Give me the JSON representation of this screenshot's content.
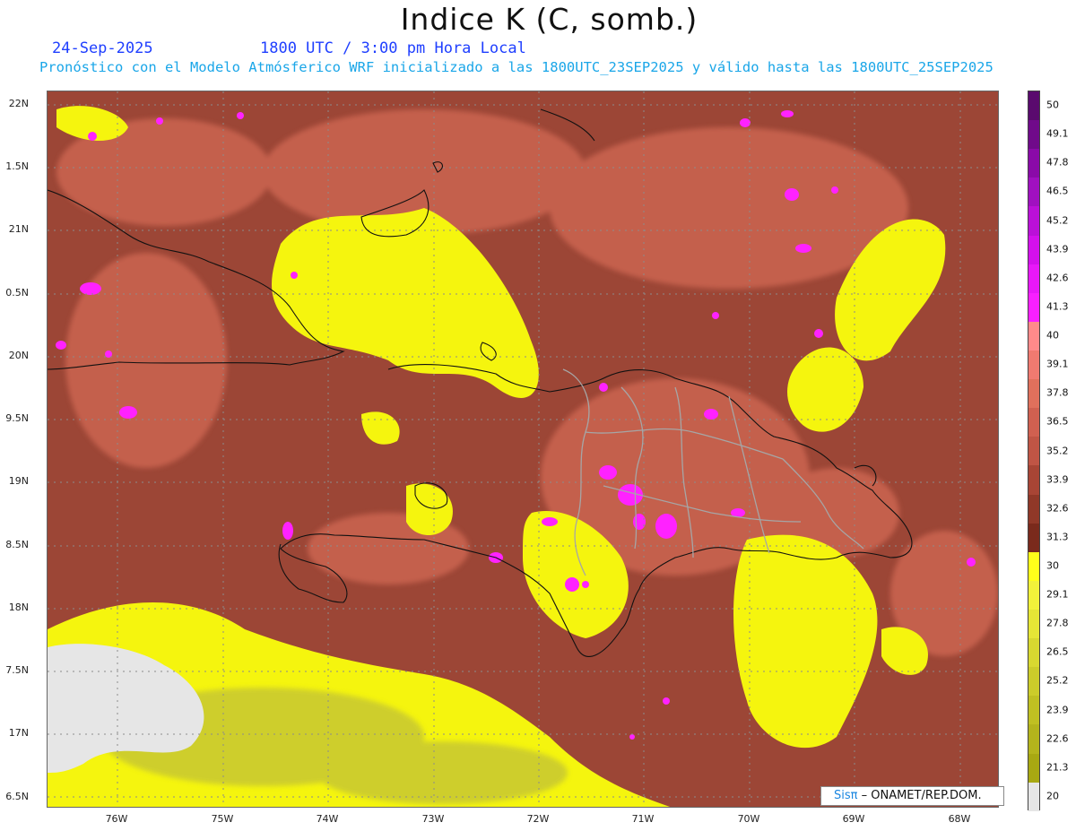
{
  "header": {
    "title": "Indice K (C, somb.)",
    "date": "24-Sep-2025",
    "time": "1800 UTC / 3:00 pm Hora Local",
    "subtitle": "Pronóstico con el Modelo Atmósferico WRF inicializado a las 1800UTC_23SEP2025 y válido hasta las  1800UTC_25SEP2025"
  },
  "axes": {
    "lat_labels": [
      "22N",
      "1.5N",
      "21N",
      "0.5N",
      "20N",
      "9.5N",
      "19N",
      "8.5N",
      "18N",
      "7.5N",
      "17N",
      "6.5N"
    ],
    "lon_labels": [
      "76W",
      "75W",
      "74W",
      "73W",
      "72W",
      "71W",
      "70W",
      "69W",
      "68W"
    ]
  },
  "colorbar": {
    "labels": [
      "50",
      "49.1",
      "47.8",
      "46.5",
      "45.2",
      "43.9",
      "42.6",
      "41.3",
      "40",
      "39.1",
      "37.8",
      "36.5",
      "35.2",
      "33.9",
      "32.6",
      "31.3",
      "30",
      "29.1",
      "27.8",
      "26.5",
      "25.2",
      "23.9",
      "22.6",
      "21.3",
      "20"
    ],
    "colors": [
      "#5a0a6e",
      "#700a8a",
      "#8a0aa8",
      "#a010c0",
      "#bb10d8",
      "#d410ec",
      "#e818f8",
      "#f820ff",
      "#ff8a8a",
      "#f07a70",
      "#e0705c",
      "#d06050",
      "#c05545",
      "#a84535",
      "#903828",
      "#7a2a1c",
      "#ffff1a",
      "#f2f23a",
      "#e6e636",
      "#d8d830",
      "#cccc2a",
      "#c0c022",
      "#b4b41c",
      "#a8a812",
      "#e6e6e6"
    ]
  },
  "credit": {
    "brand": "Sisπ",
    "text": "– ONAMET/REP.DOM."
  }
}
